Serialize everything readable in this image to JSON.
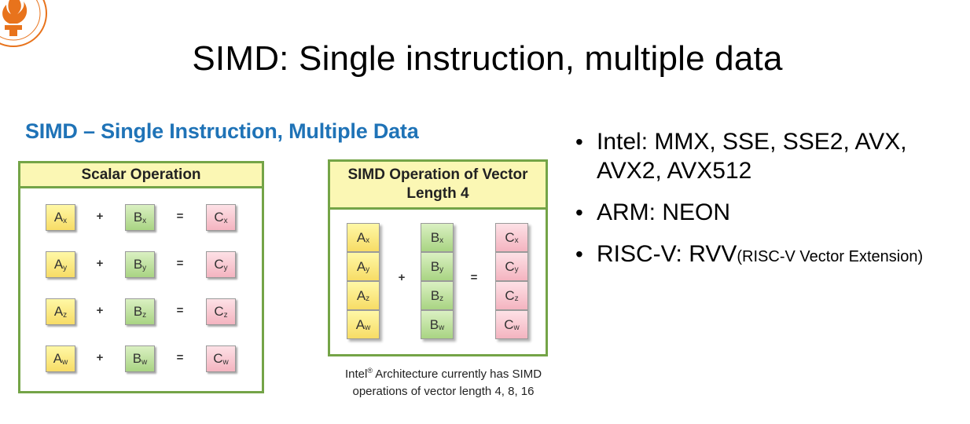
{
  "slide": {
    "title": "SIMD: Single instruction, multiple data"
  },
  "logo": {
    "icon": "university-seal-icon",
    "accent": "#e8731c"
  },
  "figure": {
    "heading": "SIMD – Single Instruction, Multiple Data",
    "heading_color": "#1f73b7",
    "scalar": {
      "header": "Scalar Operation",
      "rows": [
        {
          "a": "A",
          "a_sub": "x",
          "b": "B",
          "b_sub": "x",
          "c": "C",
          "c_sub": "x"
        },
        {
          "a": "A",
          "a_sub": "y",
          "b": "B",
          "b_sub": "y",
          "c": "C",
          "c_sub": "y"
        },
        {
          "a": "A",
          "a_sub": "z",
          "b": "B",
          "b_sub": "z",
          "c": "C",
          "c_sub": "z"
        },
        {
          "a": "A",
          "a_sub": "w",
          "b": "B",
          "b_sub": "w",
          "c": "C",
          "c_sub": "w"
        }
      ],
      "plus": "+",
      "equals": "="
    },
    "vector": {
      "header": "SIMD Operation of Vector Length 4",
      "a": [
        {
          "l": "A",
          "s": "x"
        },
        {
          "l": "A",
          "s": "y"
        },
        {
          "l": "A",
          "s": "z"
        },
        {
          "l": "A",
          "s": "w"
        }
      ],
      "b": [
        {
          "l": "B",
          "s": "x"
        },
        {
          "l": "B",
          "s": "y"
        },
        {
          "l": "B",
          "s": "z"
        },
        {
          "l": "B",
          "s": "w"
        }
      ],
      "c": [
        {
          "l": "C",
          "s": "x"
        },
        {
          "l": "C",
          "s": "y"
        },
        {
          "l": "C",
          "s": "z"
        },
        {
          "l": "C",
          "s": "w"
        }
      ],
      "plus": "+",
      "equals": "="
    },
    "caption": {
      "brand": "Intel",
      "reg": "®",
      "line1_rest": " Architecture currently has SIMD",
      "line2": "operations of vector length 4, 8, 16"
    },
    "colors": {
      "border": "#74a447",
      "header_bg": "#fbf7b4",
      "a_cell": "#f7dc66",
      "b_cell": "#a9d483",
      "c_cell": "#f4b4c0"
    }
  },
  "bullets": [
    {
      "text": "Intel: MMX, SSE, SSE2, AVX, AVX2, AVX512",
      "small": ""
    },
    {
      "text": "ARM: NEON",
      "small": ""
    },
    {
      "text": "RISC-V: RVV",
      "small": "(RISC-V Vector Extension)"
    }
  ],
  "bullet_char": "•"
}
